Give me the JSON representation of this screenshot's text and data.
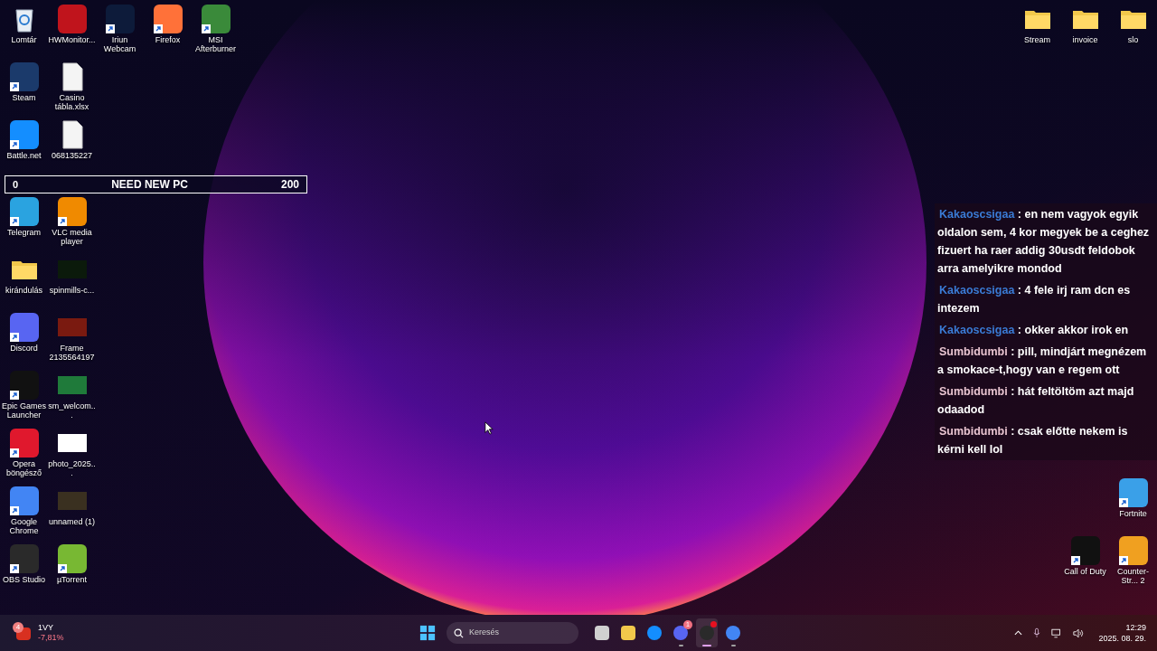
{
  "desktop_left": {
    "rows": [
      [
        {
          "label": "Lomtár",
          "kind": "recycle",
          "shortcut": false
        },
        {
          "label": "HWMonitor...",
          "kind": "app",
          "color": "#c0141c",
          "shortcut": false
        },
        {
          "label": "Iriun Webcam",
          "kind": "app",
          "color": "#0d1b3a",
          "shortcut": true
        },
        {
          "label": "Firefox",
          "kind": "app",
          "color": "#ff7139",
          "shortcut": true
        },
        {
          "label": "MSI Afterburner",
          "kind": "app",
          "color": "#3a8a3a",
          "shortcut": true
        }
      ],
      [
        {
          "label": "Steam",
          "kind": "app",
          "color": "#1b3a6b",
          "shortcut": true
        },
        {
          "label": "Casino tábla.xlsx",
          "kind": "document",
          "shortcut": false
        }
      ],
      [
        {
          "label": "Battle.net",
          "kind": "app",
          "color": "#148eff",
          "shortcut": true
        },
        {
          "label": "068135227",
          "kind": "document",
          "shortcut": false
        }
      ],
      [
        {
          "label": "Telegram",
          "kind": "app",
          "color": "#2aa3e0",
          "shortcut": true
        },
        {
          "label": "VLC media player",
          "kind": "app",
          "color": "#f08a00",
          "shortcut": true
        }
      ],
      [
        {
          "label": "kirándulás",
          "kind": "folder",
          "shortcut": false
        },
        {
          "label": "spinmills-c...",
          "kind": "image",
          "color": "#0b1a0b",
          "shortcut": false
        }
      ],
      [
        {
          "label": "Discord",
          "kind": "app",
          "color": "#5865f2",
          "shortcut": true
        },
        {
          "label": "Frame 2135564197",
          "kind": "image",
          "color": "#7a1a10",
          "shortcut": false
        }
      ],
      [
        {
          "label": "Epic Games Launcher",
          "kind": "app",
          "color": "#111111",
          "shortcut": true
        },
        {
          "label": "sm_welcom...",
          "kind": "image",
          "color": "#1f7a3a",
          "shortcut": false
        }
      ],
      [
        {
          "label": "Opera böngésző",
          "kind": "app",
          "color": "#e0182d",
          "shortcut": true
        },
        {
          "label": "photo_2025...",
          "kind": "image",
          "color": "#ffffff",
          "shortcut": false
        }
      ],
      [
        {
          "label": "Google Chrome",
          "kind": "app",
          "color": "#4285f4",
          "shortcut": true
        },
        {
          "label": "unnamed (1)",
          "kind": "image",
          "color": "#3a3020",
          "shortcut": false
        }
      ],
      [
        {
          "label": "OBS Studio",
          "kind": "app",
          "color": "#2a2a2a",
          "shortcut": true
        },
        {
          "label": "µTorrent",
          "kind": "app",
          "color": "#78b833",
          "shortcut": true
        }
      ]
    ]
  },
  "desktop_right": {
    "top": [
      {
        "label": "Stream",
        "kind": "folder",
        "shortcut": false
      },
      {
        "label": "invoice",
        "kind": "folder",
        "shortcut": false
      },
      {
        "label": "slo",
        "kind": "folder",
        "shortcut": false
      }
    ],
    "middle": [
      {
        "label": "Fortnite",
        "kind": "app",
        "color": "#3aa0e8",
        "shortcut": true
      }
    ],
    "bottom": [
      {
        "label": "Call of Duty",
        "kind": "app",
        "color": "#111111",
        "shortcut": true
      },
      {
        "label": "Counter-Str... 2",
        "kind": "app",
        "color": "#f0a020",
        "shortcut": true
      }
    ]
  },
  "goal_bar": {
    "current": "0",
    "title": "NEED NEW PC",
    "target": "200",
    "level": 0
  },
  "chat": [
    {
      "user": "Kakaoscsigaa",
      "color": "#3a7bd5",
      "text": ": en nem vagyok egyik oldalon sem, 4 kor megyek be a ceghez fizuert ha raer addig 30usdt feldobok arra amelyikre mondod"
    },
    {
      "user": "Kakaoscsigaa",
      "color": "#3a7bd5",
      "text": ": 4 fele irj ram dcn es intezem"
    },
    {
      "user": "Kakaoscsigaa",
      "color": "#3a7bd5",
      "text": ": okker akkor irok en"
    },
    {
      "user": "Sumbidumbi",
      "color": "#e8c4d0",
      "text": ": pill, mindjárt megnézem a smokace-t,hogy van e regem ott"
    },
    {
      "user": "Sumbidumbi",
      "color": "#e8c4d0",
      "text": ": hát feltöltöm azt majd odaadod"
    },
    {
      "user": "Sumbidumbi",
      "color": "#e8c4d0",
      "text": ": csak előtte nekem is kérni kell lol"
    }
  ],
  "taskbar": {
    "widget": {
      "badge": "4",
      "ticker": "1VY",
      "change": "-7,81%"
    },
    "search": {
      "placeholder": "Keresés"
    },
    "apps": [
      {
        "kind": "task_view",
        "running": false,
        "selected": false,
        "dot": false
      },
      {
        "kind": "explorer",
        "running": false,
        "selected": false,
        "dot": false
      },
      {
        "kind": "battlenet",
        "running": false,
        "selected": false,
        "dot": false
      },
      {
        "kind": "discord",
        "running": true,
        "selected": false,
        "badge": "1",
        "dot": false
      },
      {
        "kind": "obs",
        "running": true,
        "selected": true,
        "dot": true
      },
      {
        "kind": "chrome",
        "running": true,
        "selected": false,
        "dot": false
      }
    ],
    "time": "12:29",
    "date": "2025. 08. 29."
  }
}
